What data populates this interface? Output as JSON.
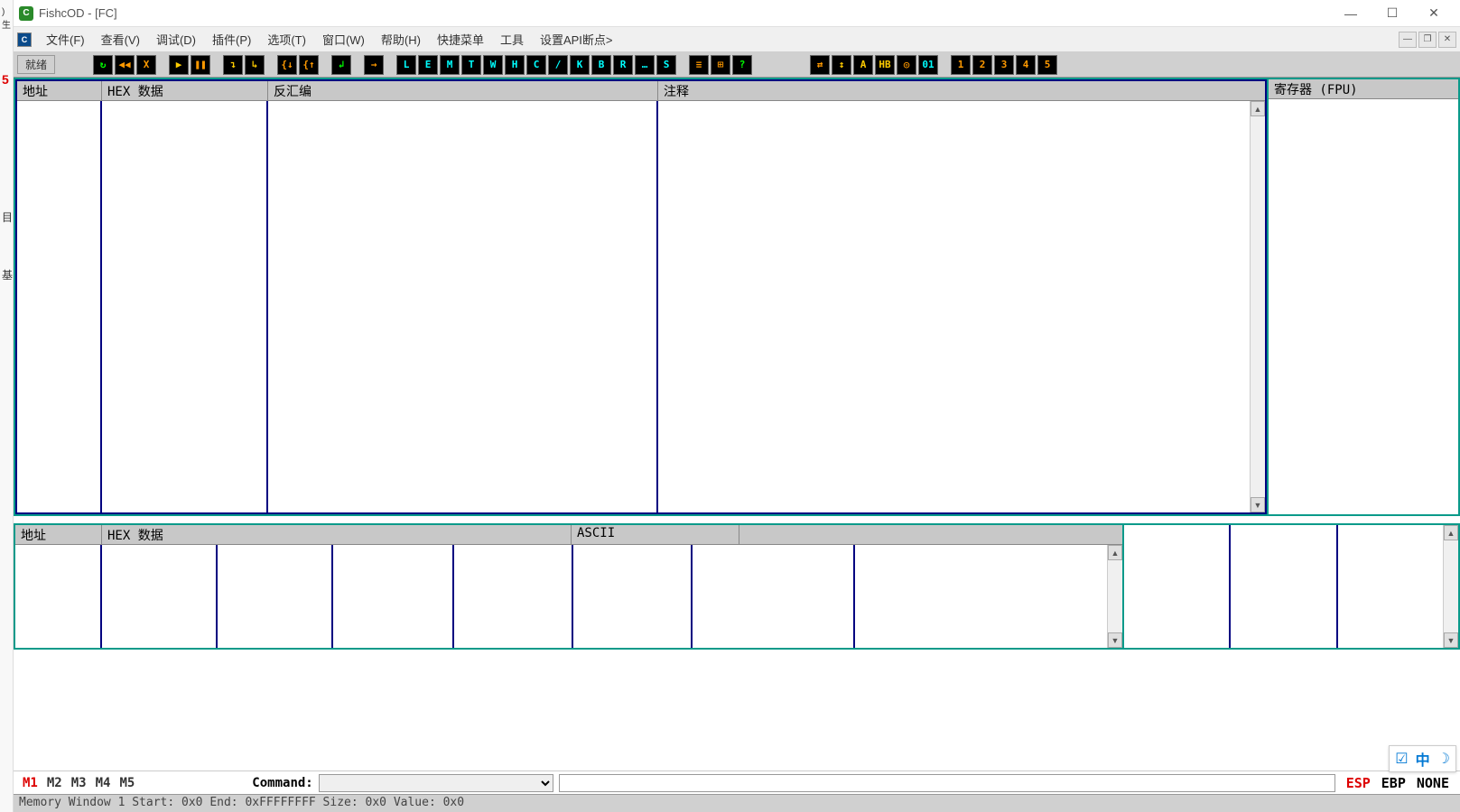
{
  "title": "FishcOD - [FC]",
  "left_gutter": {
    "g1": ")生",
    "g2": "5",
    "g3": "目",
    "g4": "基"
  },
  "menu": {
    "items": [
      "文件(F)",
      "查看(V)",
      "调试(D)",
      "插件(P)",
      "选项(T)",
      "窗口(W)",
      "帮助(H)",
      "快捷菜单",
      "工具",
      "设置API断点>"
    ],
    "mini_icon": "C"
  },
  "toolbar": {
    "status": "就绪",
    "group1": [
      {
        "g": "↻",
        "c": "green"
      },
      {
        "g": "◀◀",
        "c": "orange"
      },
      {
        "g": "X",
        "c": "orange"
      }
    ],
    "group2": [
      {
        "g": "▶",
        "c": "yellow"
      },
      {
        "g": "❚❚",
        "c": "orange"
      }
    ],
    "group3": [
      {
        "g": "↴",
        "c": "yellow"
      },
      {
        "g": "↳",
        "c": "yellow"
      }
    ],
    "group4": [
      {
        "g": "{↓",
        "c": "orange"
      },
      {
        "g": "{↑",
        "c": "orange"
      }
    ],
    "group5": [
      {
        "g": "↲",
        "c": "green"
      }
    ],
    "group6": [
      {
        "g": "→",
        "c": "orange"
      }
    ],
    "letters": [
      {
        "g": "L",
        "c": "cyan"
      },
      {
        "g": "E",
        "c": "cyan"
      },
      {
        "g": "M",
        "c": "cyan"
      },
      {
        "g": "T",
        "c": "cyan"
      },
      {
        "g": "W",
        "c": "cyan"
      },
      {
        "g": "H",
        "c": "cyan"
      },
      {
        "g": "C",
        "c": "cyan"
      },
      {
        "g": "/",
        "c": "cyan"
      },
      {
        "g": "K",
        "c": "cyan"
      },
      {
        "g": "B",
        "c": "cyan"
      },
      {
        "g": "R",
        "c": "cyan"
      },
      {
        "g": "…",
        "c": "cyan"
      },
      {
        "g": "S",
        "c": "cyan"
      }
    ],
    "group7": [
      {
        "g": "≡",
        "c": "orange"
      },
      {
        "g": "⊞",
        "c": "orange"
      },
      {
        "g": "?",
        "c": "green"
      }
    ],
    "group8": [
      {
        "g": "⇄",
        "c": "orange"
      },
      {
        "g": "↕",
        "c": "yellow"
      },
      {
        "g": "A",
        "c": "yellow"
      },
      {
        "g": "HB",
        "c": "yellow"
      },
      {
        "g": "◎",
        "c": "orange"
      },
      {
        "g": "01",
        "c": "cyan"
      }
    ],
    "nums": [
      {
        "g": "1",
        "c": "orange"
      },
      {
        "g": "2",
        "c": "orange"
      },
      {
        "g": "3",
        "c": "orange"
      },
      {
        "g": "4",
        "c": "orange"
      },
      {
        "g": "5",
        "c": "orange"
      }
    ]
  },
  "panes": {
    "disasm_cols": [
      "地址",
      "HEX 数据",
      "反汇编",
      "注释"
    ],
    "reg_header": "寄存器 (FPU)",
    "dump_cols": [
      "地址",
      "HEX 数据",
      "ASCII",
      ""
    ],
    "disasm_widths": [
      94,
      184,
      432,
      478
    ],
    "dump_widths": [
      96,
      520,
      186,
      210
    ],
    "dump_body_widths": [
      96,
      128,
      128,
      134,
      132,
      132,
      180,
      124
    ]
  },
  "cmdbar": {
    "mem_tabs": [
      "M1",
      "M2",
      "M3",
      "M4",
      "M5"
    ],
    "active_tab": "M1",
    "label": "Command:",
    "regs": [
      "ESP",
      "EBP",
      "NONE"
    ]
  },
  "status_line": "Memory Window 1  Start: 0x0  End: 0xFFFFFFFF  Size: 0x0 Value: 0x0",
  "ime": {
    "a": "☑",
    "b": "中",
    "c": "☽"
  }
}
